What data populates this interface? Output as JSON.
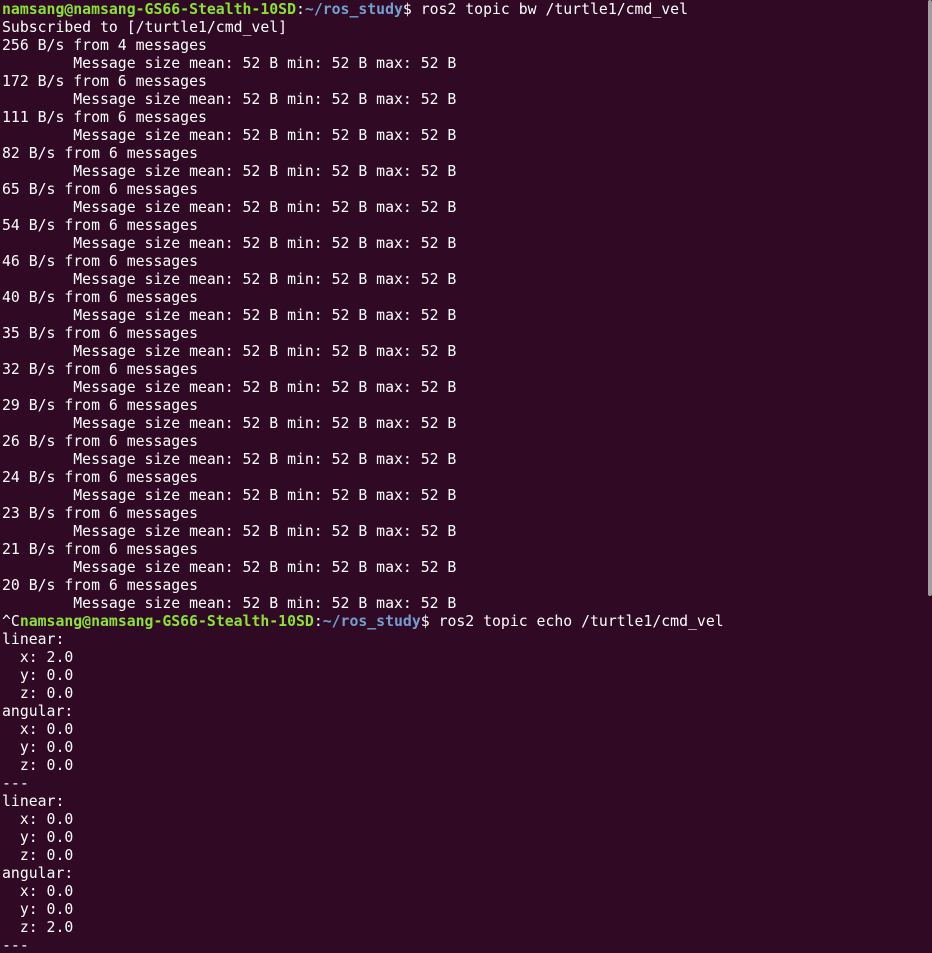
{
  "terminal": {
    "prompt": {
      "user_host": "namsang@namsang-GS66-Stealth-10SD",
      "path": "~/ros_study",
      "symbol": "$"
    },
    "interrupt": "^C",
    "commands": [
      " ros2 topic bw /turtle1/cmd_vel",
      " ros2 topic echo /turtle1/cmd_vel"
    ],
    "subscribed": "Subscribed to [/turtle1/cmd_vel]",
    "size_line": "        Message size mean: 52 B min: 52 B max: 52 B",
    "bw_rates": [
      "256 B/s from 4 messages",
      "172 B/s from 6 messages",
      "111 B/s from 6 messages",
      "82 B/s from 6 messages",
      "65 B/s from 6 messages",
      "54 B/s from 6 messages",
      "46 B/s from 6 messages",
      "40 B/s from 6 messages",
      "35 B/s from 6 messages",
      "32 B/s from 6 messages",
      "29 B/s from 6 messages",
      "26 B/s from 6 messages",
      "24 B/s from 6 messages",
      "23 B/s from 6 messages",
      "21 B/s from 6 messages",
      "20 B/s from 6 messages"
    ],
    "echo_lines": [
      "linear:",
      "  x: 2.0",
      "  y: 0.0",
      "  z: 0.0",
      "angular:",
      "  x: 0.0",
      "  y: 0.0",
      "  z: 0.0",
      "---",
      "linear:",
      "  x: 0.0",
      "  y: 0.0",
      "  z: 0.0",
      "angular:",
      "  x: 0.0",
      "  y: 0.0",
      "  z: 2.0",
      "---"
    ],
    "colors": {
      "background": "#300a24",
      "text": "#ffffff",
      "user_host": "#8ae234",
      "path": "#729fcf"
    }
  }
}
